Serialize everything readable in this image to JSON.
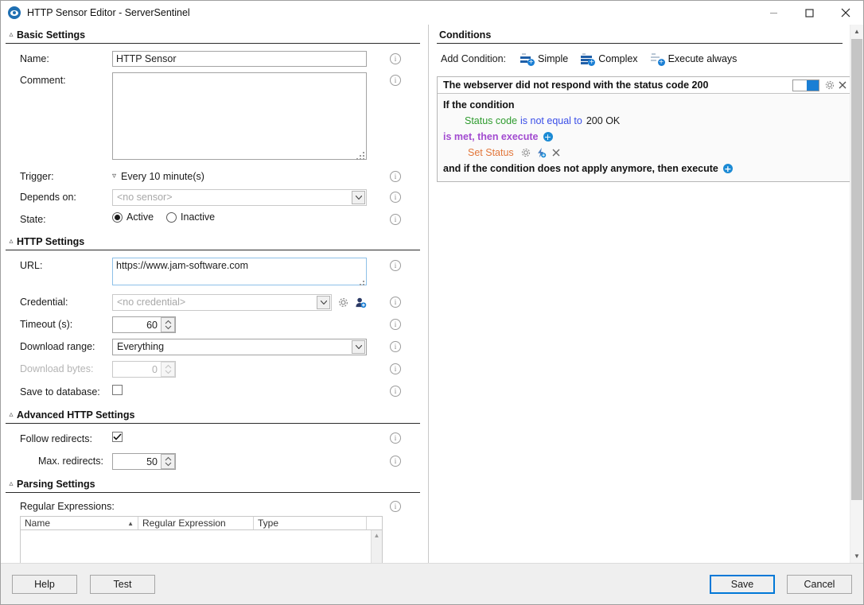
{
  "window": {
    "title": "HTTP Sensor Editor - ServerSentinel",
    "app_icon": "eye-icon",
    "minimize_label": "Minimize",
    "maximize_label": "Maximize",
    "close_label": "Close"
  },
  "sections": {
    "basic": "Basic Settings",
    "http": "HTTP Settings",
    "advanced": "Advanced HTTP Settings",
    "parsing": "Parsing Settings"
  },
  "basic": {
    "name_label": "Name:",
    "name_value": "HTTP Sensor",
    "comment_label": "Comment:",
    "comment_value": "",
    "trigger_label": "Trigger:",
    "trigger_value": "Every 10 minute(s)",
    "depends_label": "Depends on:",
    "depends_value": "<no sensor>",
    "state_label": "State:",
    "state_active": "Active",
    "state_inactive": "Inactive",
    "state_selected": "Active"
  },
  "http": {
    "url_label": "URL:",
    "url_value": "https://www.jam-software.com",
    "credential_label": "Credential:",
    "credential_value": "<no credential>",
    "timeout_label": "Timeout (s):",
    "timeout_value": "60",
    "range_label": "Download range:",
    "range_value": "Everything",
    "bytes_label": "Download bytes:",
    "bytes_value": "0",
    "save_db_label": "Save to database:",
    "save_db_checked": false
  },
  "advanced": {
    "follow_label": "Follow redirects:",
    "follow_checked": true,
    "max_label": "Max. redirects:",
    "max_value": "50"
  },
  "parsing": {
    "regex_label": "Regular Expressions:",
    "columns": [
      "Name",
      "Regular Expression",
      "Type",
      ""
    ],
    "rows": []
  },
  "conditions": {
    "header": "Conditions",
    "add_label": "Add Condition:",
    "buttons": [
      {
        "label": "Simple",
        "icon": "add-simple-condition-icon"
      },
      {
        "label": "Complex",
        "icon": "add-complex-condition-icon"
      },
      {
        "label": "Execute always",
        "icon": "add-execute-always-icon"
      }
    ],
    "card": {
      "title": "The webserver did not respond with the status code 200",
      "enabled": true,
      "if_line": "If the condition",
      "expr_subject": "Status code",
      "expr_operator": "is not equal to",
      "expr_value": "200 OK",
      "then_line": "is met, then execute",
      "action": "Set Status",
      "else_line": "and if the condition does not apply anymore, then execute"
    }
  },
  "footer": {
    "help": "Help",
    "test": "Test",
    "save": "Save",
    "cancel": "Cancel"
  },
  "colors": {
    "accent": "#1b7fd4",
    "subject": "#2e9b2e",
    "operator": "#3a4ee8",
    "connector": "#a24bd0",
    "action": "#e2763a",
    "primary_border": "#0078d7"
  },
  "icons": {
    "info": "info-icon",
    "gear": "gear-icon",
    "close_small": "close-icon",
    "lightning": "lightning-icon",
    "add_user": "add-user-icon",
    "chevron_up": "chevron-up-icon",
    "chevron_down": "chevron-down-icon"
  }
}
